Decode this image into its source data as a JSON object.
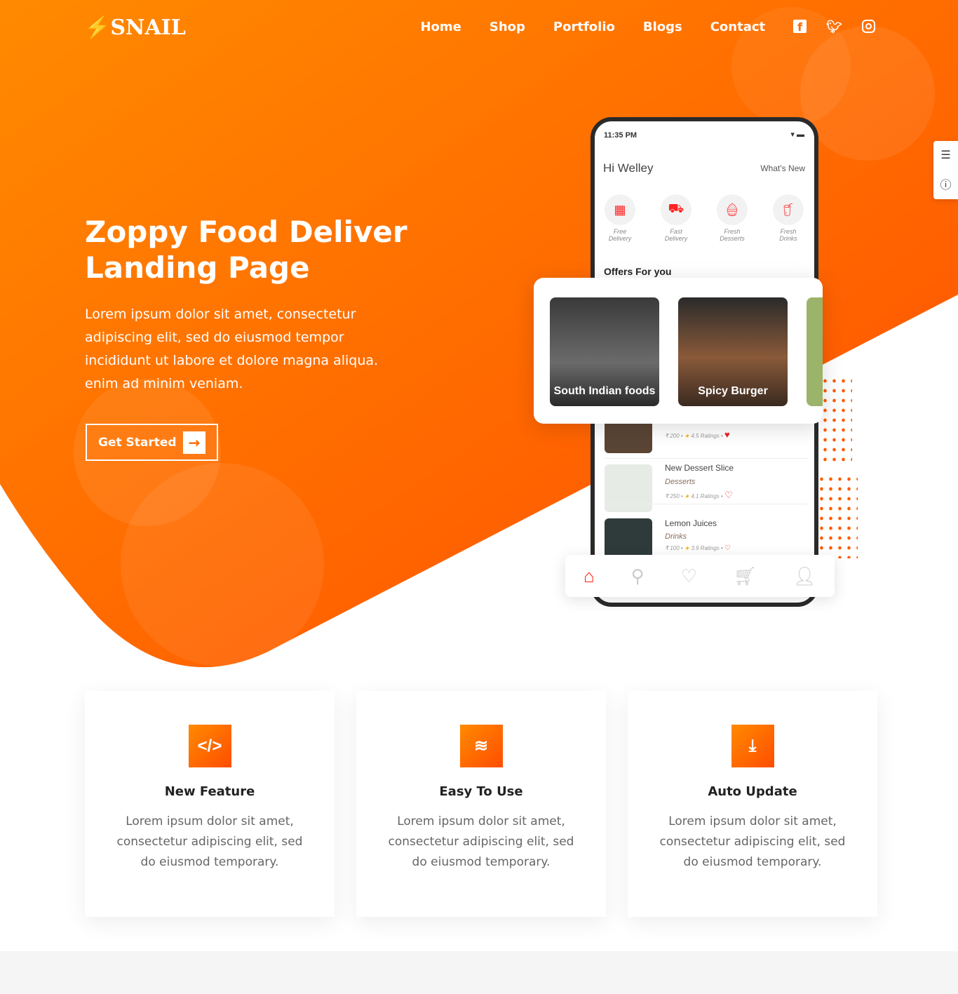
{
  "brand": {
    "name": "SNAIL"
  },
  "nav": {
    "items": [
      "Home",
      "Shop",
      "Portfolio",
      "Blogs",
      "Contact"
    ],
    "social": [
      "facebook-icon",
      "twitter-icon",
      "instagram-icon"
    ]
  },
  "hero": {
    "title": "Zoppy Food Deliver Landing Page",
    "text": "Lorem ipsum dolor sit amet, consectetur adipiscing elit, sed do eiusmod tempor incididunt ut labore et dolore magna aliqua. enim ad minim veniam.",
    "cta": "Get Started"
  },
  "colors": {
    "accent": "#ff6a00",
    "accent_dark": "#ff4d00"
  },
  "phone": {
    "time": "11:35 PM",
    "greeting": "Hi Welley",
    "whats_new": "What's New",
    "categories": [
      "Free Delivery",
      "Fast Delivery",
      "Fresh Desserts",
      "Fresh Drinks"
    ],
    "offers_title": "Offers For you",
    "offers": [
      "South Indian foods",
      "Spicy Burger"
    ],
    "items": [
      {
        "name": "",
        "type": "",
        "price": "₹ 200",
        "rating": "4.5 Ratings",
        "liked": true
      },
      {
        "name": "New Dessert Slice",
        "type": "Desserts",
        "price": "₹ 250",
        "rating": "4.1 Ratings",
        "liked": false
      },
      {
        "name": "Lemon Juices",
        "type": "Drinks",
        "price": "₹ 100",
        "rating": "3.9 Ratings",
        "liked": false
      }
    ]
  },
  "features": [
    {
      "icon": "code-icon",
      "title": "New Feature",
      "text": "Lorem ipsum dolor sit amet, consectetur adipiscing elit, sed do eiusmod temporary."
    },
    {
      "icon": "layers-icon",
      "title": "Easy To Use",
      "text": "Lorem ipsum dolor sit amet, consectetur adipiscing elit, sed do eiusmod temporary."
    },
    {
      "icon": "download-icon",
      "title": "Auto Update",
      "text": "Lorem ipsum dolor sit amet, consectetur adipiscing elit, sed do eiusmod temporary."
    }
  ]
}
